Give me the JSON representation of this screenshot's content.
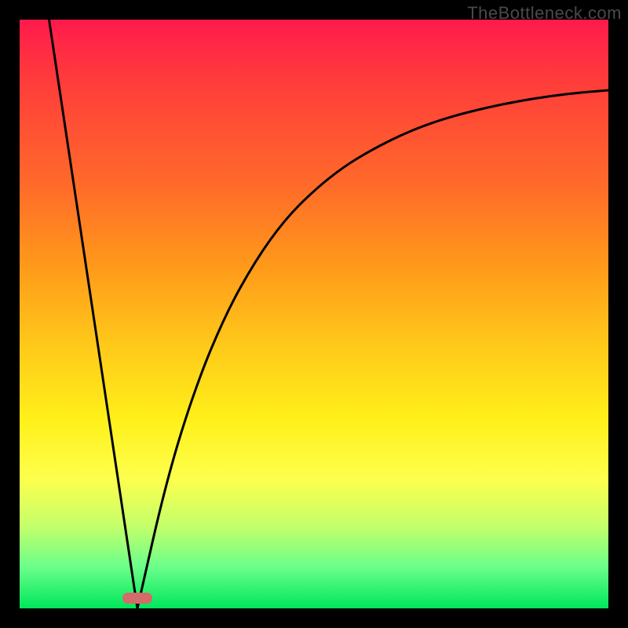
{
  "watermark": "TheBottleneck.com",
  "chart_data": {
    "type": "line",
    "title": "",
    "xlabel": "",
    "ylabel": "",
    "xlim": [
      0,
      100
    ],
    "ylim": [
      0,
      100
    ],
    "background_gradient": {
      "top": "#ff1a4d",
      "bottom": "#00e65c",
      "description": "vertical red-to-green gradient"
    },
    "series": [
      {
        "name": "left-branch",
        "x": [
          5,
          20
        ],
        "y": [
          100,
          0
        ],
        "shape": "linear"
      },
      {
        "name": "right-branch",
        "x": [
          20,
          25,
          30,
          35,
          40,
          45,
          50,
          55,
          60,
          65,
          70,
          75,
          80,
          85,
          90,
          95,
          100
        ],
        "y": [
          0,
          22,
          38,
          50,
          59,
          66,
          71,
          75,
          78,
          80.5,
          82.5,
          84,
          85.2,
          86.2,
          87,
          87.6,
          88
        ],
        "shape": "concave-increasing"
      }
    ],
    "marker": {
      "name": "minimum-marker",
      "x": 20,
      "y": 0,
      "color": "#d46a6a"
    }
  },
  "colors": {
    "frame_border": "#000000",
    "curve": "#000000",
    "marker": "#d46a6a",
    "watermark": "#4a4a4a"
  }
}
